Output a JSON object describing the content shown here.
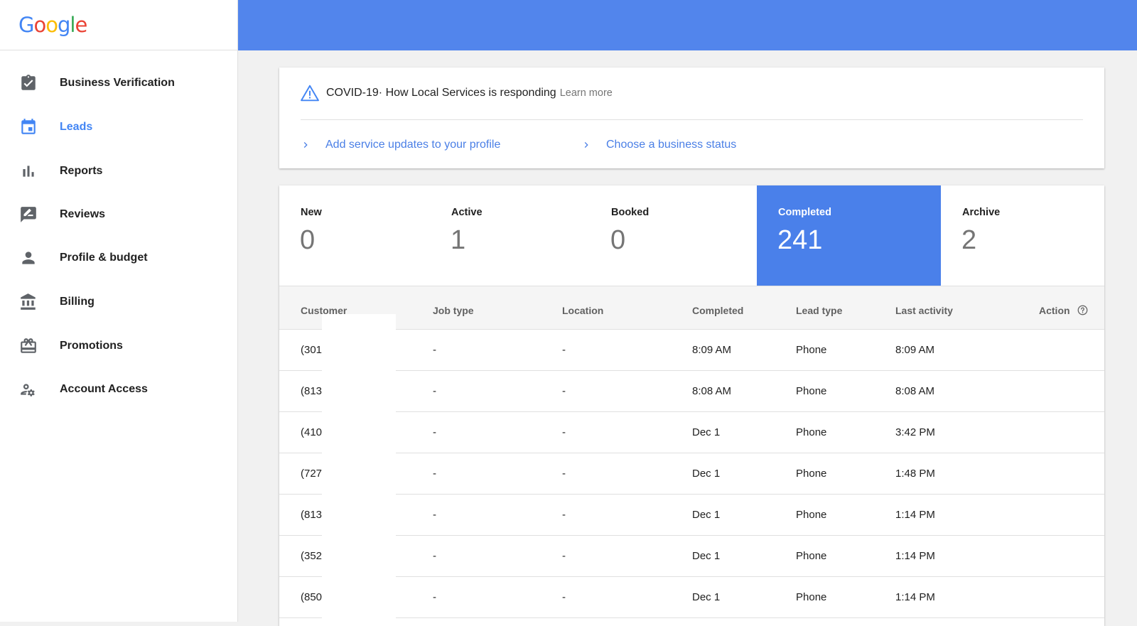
{
  "brand": {
    "logo_letters": [
      {
        "ch": "G",
        "color": "#4285f4"
      },
      {
        "ch": "o",
        "color": "#ea4335"
      },
      {
        "ch": "o",
        "color": "#fbbc05"
      },
      {
        "ch": "g",
        "color": "#4285f4"
      },
      {
        "ch": "l",
        "color": "#34a853"
      },
      {
        "ch": "e",
        "color": "#ea4335"
      }
    ]
  },
  "colors": {
    "accent": "#4285f4",
    "header": "#5285ec",
    "active_tab": "#4a80ea"
  },
  "sidebar": {
    "items": [
      {
        "label": "Business Verification",
        "icon": "clipboard-check-icon",
        "active": false
      },
      {
        "label": "Leads",
        "icon": "calendar-icon",
        "active": true
      },
      {
        "label": "Reports",
        "icon": "bar-chart-icon",
        "active": false
      },
      {
        "label": "Reviews",
        "icon": "review-pen-icon",
        "active": false
      },
      {
        "label": "Profile & budget",
        "icon": "person-icon",
        "active": false
      },
      {
        "label": "Billing",
        "icon": "bank-icon",
        "active": false
      },
      {
        "label": "Promotions",
        "icon": "gift-card-icon",
        "active": false
      },
      {
        "label": "Account Access",
        "icon": "user-gear-icon",
        "active": false
      }
    ]
  },
  "covid": {
    "icon": "warning-triangle-icon",
    "title": "COVID-19",
    "subtitle": " · How Local Services is responding",
    "learn_more": "Learn more",
    "links": [
      {
        "label": "Add service updates to your profile",
        "icon": "chevron-right-icon"
      },
      {
        "label": "Choose a business status",
        "icon": "chevron-right-icon"
      }
    ]
  },
  "stats": [
    {
      "label": "New",
      "value": "0",
      "active": false
    },
    {
      "label": "Active",
      "value": "1",
      "active": false
    },
    {
      "label": "Booked",
      "value": "0",
      "active": false
    },
    {
      "label": "Completed",
      "value": "241",
      "active": true
    },
    {
      "label": "Archive",
      "value": "2",
      "active": false
    }
  ],
  "table": {
    "columns": [
      "Customer",
      "Job type",
      "Location",
      "Completed",
      "Lead type",
      "Last activity",
      "Action"
    ],
    "action_help_icon": "help-circle-icon",
    "rows": [
      [
        "(301",
        "-",
        "-",
        "8:09 AM",
        "Phone",
        "8:09 AM"
      ],
      [
        "(813",
        "-",
        "-",
        "8:08 AM",
        "Phone",
        "8:08 AM"
      ],
      [
        "(410",
        "-",
        "-",
        "Dec 1",
        "Phone",
        "3:42 PM"
      ],
      [
        "(727",
        "-",
        "-",
        "Dec 1",
        "Phone",
        "1:48 PM"
      ],
      [
        "(813",
        "-",
        "-",
        "Dec 1",
        "Phone",
        "1:14 PM"
      ],
      [
        "(352",
        "-",
        "-",
        "Dec 1",
        "Phone",
        "1:14 PM"
      ],
      [
        "(850",
        "-",
        "-",
        "Dec 1",
        "Phone",
        "1:14 PM"
      ]
    ]
  }
}
